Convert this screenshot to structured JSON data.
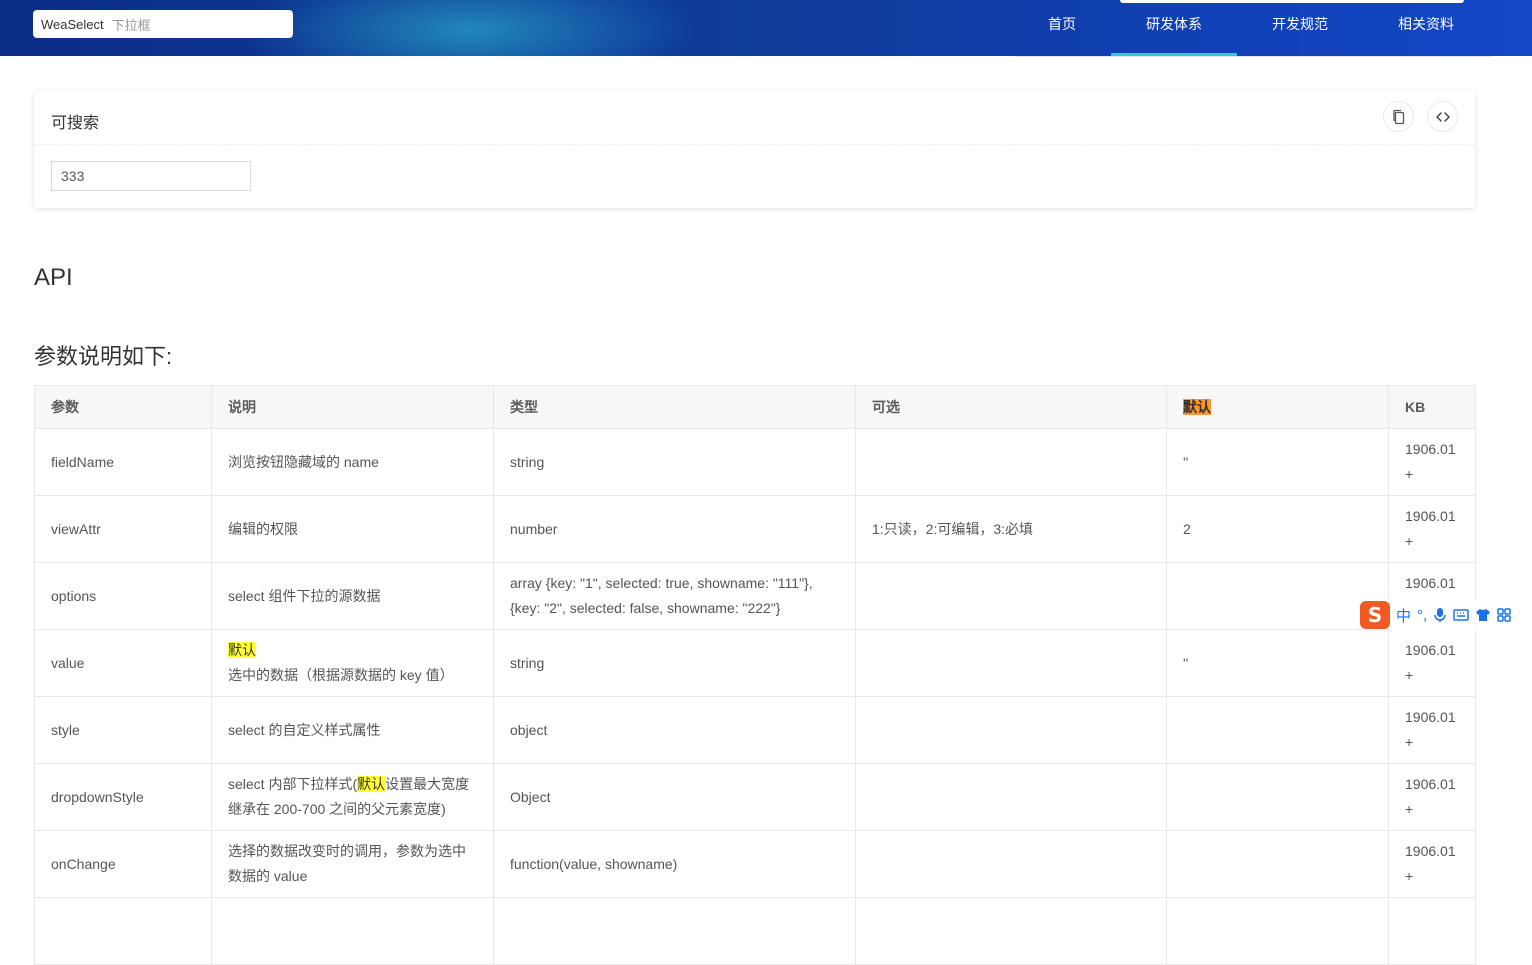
{
  "header": {
    "search_value": "WeaSelect",
    "search_placeholder": "下拉框",
    "nav": [
      {
        "label": "首页",
        "active": false
      },
      {
        "label": "研发体系",
        "active": true
      },
      {
        "label": "开发规范",
        "active": false
      },
      {
        "label": "相关资料",
        "active": false
      }
    ]
  },
  "demo": {
    "title": "可搜索",
    "input_value": "333",
    "icons": [
      "copy-icon",
      "code-icon"
    ]
  },
  "headings": {
    "api": "API",
    "params": "参数说明如下:"
  },
  "table": {
    "headers": [
      "参数",
      "说明",
      "类型",
      "可选",
      "默认",
      "KB"
    ],
    "rows": [
      {
        "param": "fieldName",
        "desc": "浏览按钮隐藏域的 name",
        "type": "string",
        "options": "",
        "default": "''",
        "kb": "1906.01",
        "kb_plus": "+"
      },
      {
        "param": "viewAttr",
        "desc": "编辑的权限",
        "type": "number",
        "options": "1:只读，2:可编辑，3:必填",
        "default": "2",
        "kb": "1906.01",
        "kb_plus": "+"
      },
      {
        "param": "options",
        "desc": "select 组件下拉的源数据",
        "type": "array {key: \"1\", selected: true, showname: \"111\"},{key: \"2\", selected: false, showname: \"222\"}",
        "options": "",
        "default": "",
        "kb": "1906.01",
        "kb_plus": ""
      },
      {
        "param": "value",
        "desc_hl": "默认",
        "desc_rest": "选中的数据（根据源数据的 key 值）",
        "type": "string",
        "options": "",
        "default": "''",
        "kb": "1906.01",
        "kb_plus": "+"
      },
      {
        "param": "style",
        "desc": "select 的自定义样式属性",
        "type": "object",
        "options": "",
        "default": "",
        "kb": "1906.01",
        "kb_plus": "+"
      },
      {
        "param": "dropdownStyle",
        "desc_pre": "select 内部下拉样式(",
        "desc_hl": "默认",
        "desc_rest": "设置最大宽度继承在 200-700 之间的父元素宽度)",
        "type": "Object",
        "options": "",
        "default": "",
        "kb": "1906.01",
        "kb_plus": "+"
      },
      {
        "param": "onChange",
        "desc": "选择的数据改变时的调用，参数为选中数据的 value",
        "type": "function(value, showname)",
        "options": "",
        "default": "",
        "kb": "1906.01",
        "kb_plus": "+"
      }
    ]
  },
  "ime": {
    "logo": "S",
    "lang": "中",
    "icons": [
      "punctuation-icon",
      "microphone-icon",
      "keyboard-icon",
      "skin-icon",
      "grid-icon"
    ]
  }
}
